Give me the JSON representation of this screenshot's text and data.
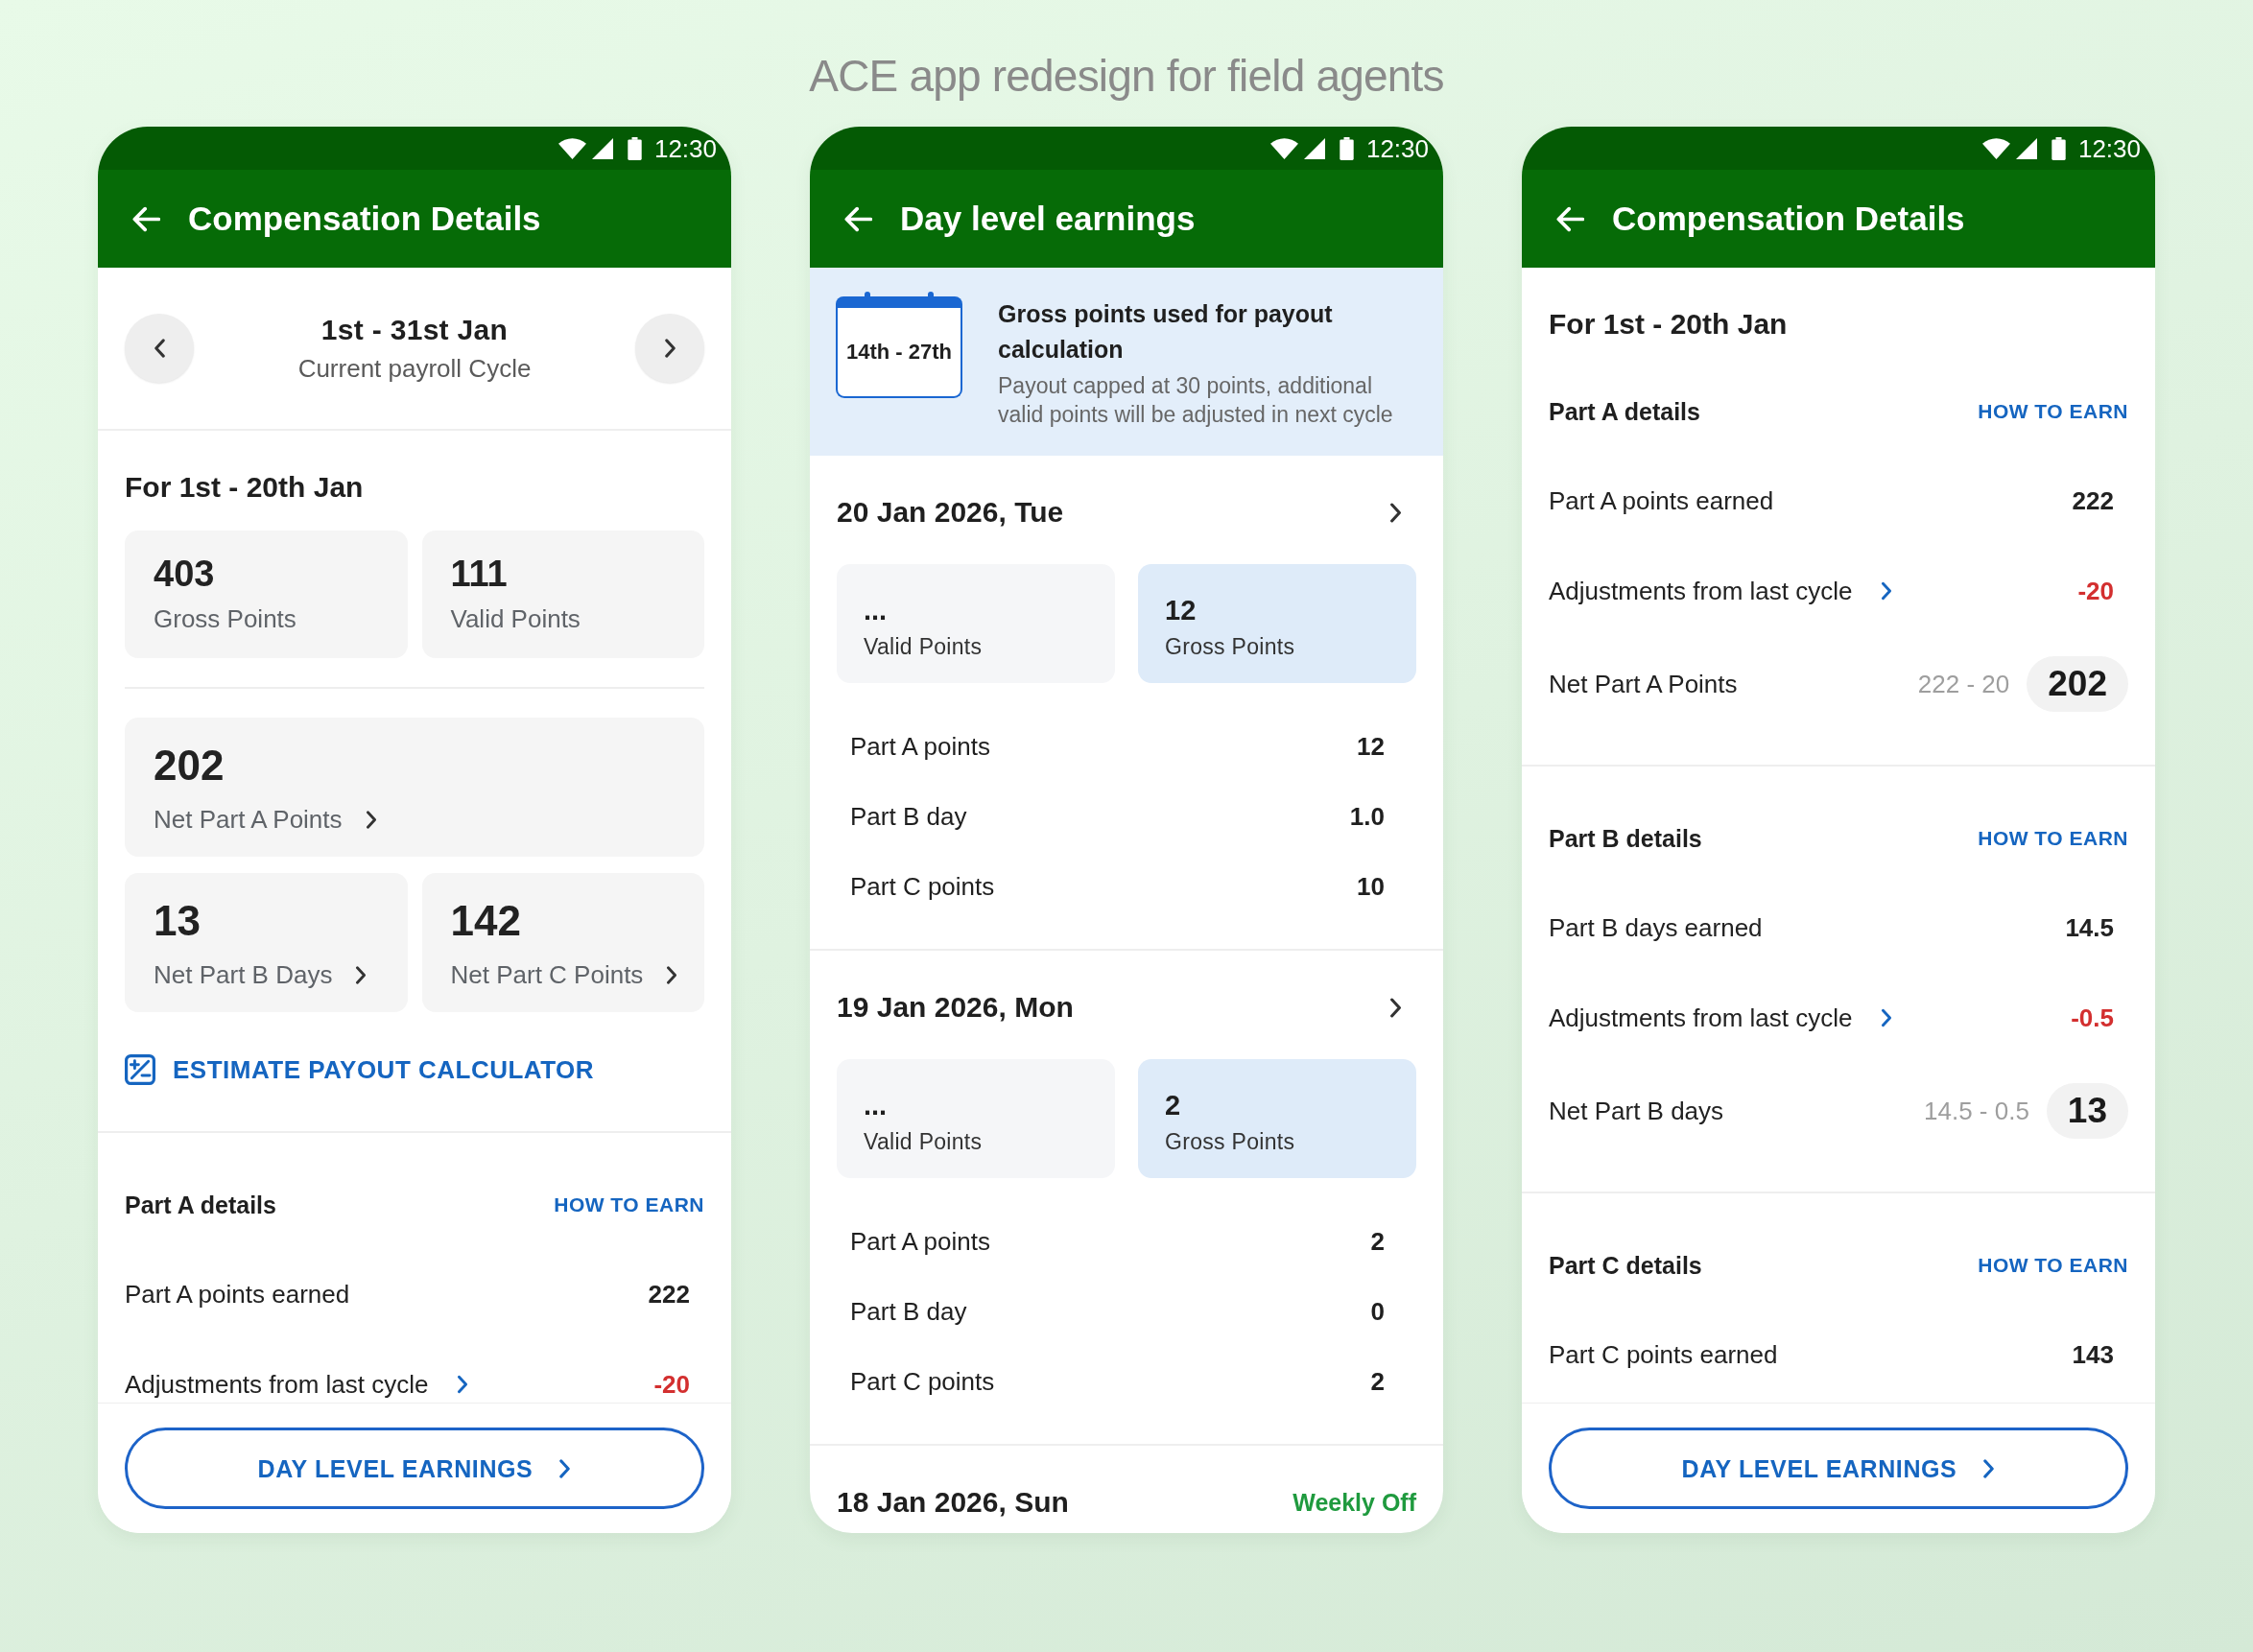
{
  "page_title": "ACE app redesign for field agents",
  "screens": [
    {
      "status_bar": {
        "time": "12:30"
      },
      "app_bar": {
        "title": "Compensation Details"
      },
      "sections": [
        {
          "kind": "cycle_nav",
          "title": "1st - 31st Jan",
          "subtitle": "Current payroll Cycle"
        },
        {
          "kind": "summary",
          "heading": "For 1st - 20th Jan",
          "stat_groups": [
            {
              "rows": [
                {
                  "cards": [
                    {
                      "value": "403",
                      "label": "Gross Points",
                      "chevron": false
                    },
                    {
                      "value": "111",
                      "label": "Valid Points",
                      "chevron": false
                    }
                  ]
                }
              ]
            },
            {
              "rows": [
                {
                  "cards": [
                    {
                      "value": "202",
                      "label": "Net Part A Points",
                      "chevron": true
                    }
                  ]
                },
                {
                  "cards": [
                    {
                      "value": "13",
                      "label": "Net Part B Days",
                      "chevron": true
                    },
                    {
                      "value": "142",
                      "label": "Net Part C Points",
                      "chevron": true
                    }
                  ]
                }
              ]
            }
          ],
          "link": {
            "label": "ESTIMATE PAYOUT CALCULATOR"
          }
        },
        {
          "kind": "details",
          "title": "Part A details",
          "action": "HOW TO EARN",
          "rows": [
            {
              "kind": "earned",
              "label": "Part A points earned",
              "value": "222"
            },
            {
              "kind": "adjustment",
              "label": "Adjustments from last cycle",
              "value": "-20"
            }
          ]
        }
      ],
      "footer_button": {
        "label": "DAY LEVEL EARNINGS"
      }
    },
    {
      "status_bar": {
        "time": "12:30"
      },
      "app_bar": {
        "title": "Day level earnings"
      },
      "sections": [
        {
          "kind": "banner",
          "calendar_label": "14th - 27th",
          "title": "Gross points used for payout calculation",
          "description": "Payout capped at 30 points, additional valid points will be adjusted in next cycle"
        },
        {
          "kind": "day",
          "date": "20 Jan 2026, Tue",
          "cards": [
            {
              "value": "...",
              "label": "Valid Points",
              "highlighted": false
            },
            {
              "value": "12",
              "label": "Gross Points",
              "highlighted": true
            }
          ],
          "rows": [
            {
              "label": "Part A points",
              "value": "12"
            },
            {
              "label": "Part B day",
              "value": "1.0"
            },
            {
              "label": "Part C points",
              "value": "10"
            }
          ]
        },
        {
          "kind": "day",
          "date": "19 Jan 2026, Mon",
          "cards": [
            {
              "value": "...",
              "label": "Valid Points",
              "highlighted": false
            },
            {
              "value": "2",
              "label": "Gross Points",
              "highlighted": true
            }
          ],
          "rows": [
            {
              "label": "Part A points",
              "value": "2"
            },
            {
              "label": "Part B day",
              "value": "0"
            },
            {
              "label": "Part C points",
              "value": "2"
            }
          ]
        },
        {
          "kind": "day",
          "date": "18 Jan 2026, Sun",
          "status": "Weekly Off"
        }
      ]
    },
    {
      "status_bar": {
        "time": "12:30"
      },
      "app_bar": {
        "title": "Compensation Details"
      },
      "sections": [
        {
          "kind": "details",
          "heading": "For 1st - 20th Jan",
          "title": "Part A details",
          "action": "HOW TO EARN",
          "rows": [
            {
              "kind": "earned",
              "label": "Part A points earned",
              "value": "222"
            },
            {
              "kind": "adjustment",
              "label": "Adjustments from last cycle",
              "value": "-20"
            },
            {
              "kind": "net",
              "label": "Net Part A Points",
              "formula": "222 - 20",
              "value": "202"
            }
          ]
        },
        {
          "kind": "details",
          "title": "Part B details",
          "action": "HOW TO EARN",
          "rows": [
            {
              "kind": "earned",
              "label": "Part B days earned",
              "value": "14.5"
            },
            {
              "kind": "adjustment",
              "label": "Adjustments from last cycle",
              "value": "-0.5"
            },
            {
              "kind": "net",
              "label": "Net Part B days",
              "formula": "14.5 - 0.5",
              "value": "13"
            }
          ]
        },
        {
          "kind": "details",
          "title": "Part C details",
          "action": "HOW TO EARN",
          "rows": [
            {
              "kind": "earned",
              "label": "Part C points earned",
              "value": "143"
            }
          ]
        }
      ],
      "footer_button": {
        "label": "DAY LEVEL EARNINGS"
      }
    }
  ]
}
